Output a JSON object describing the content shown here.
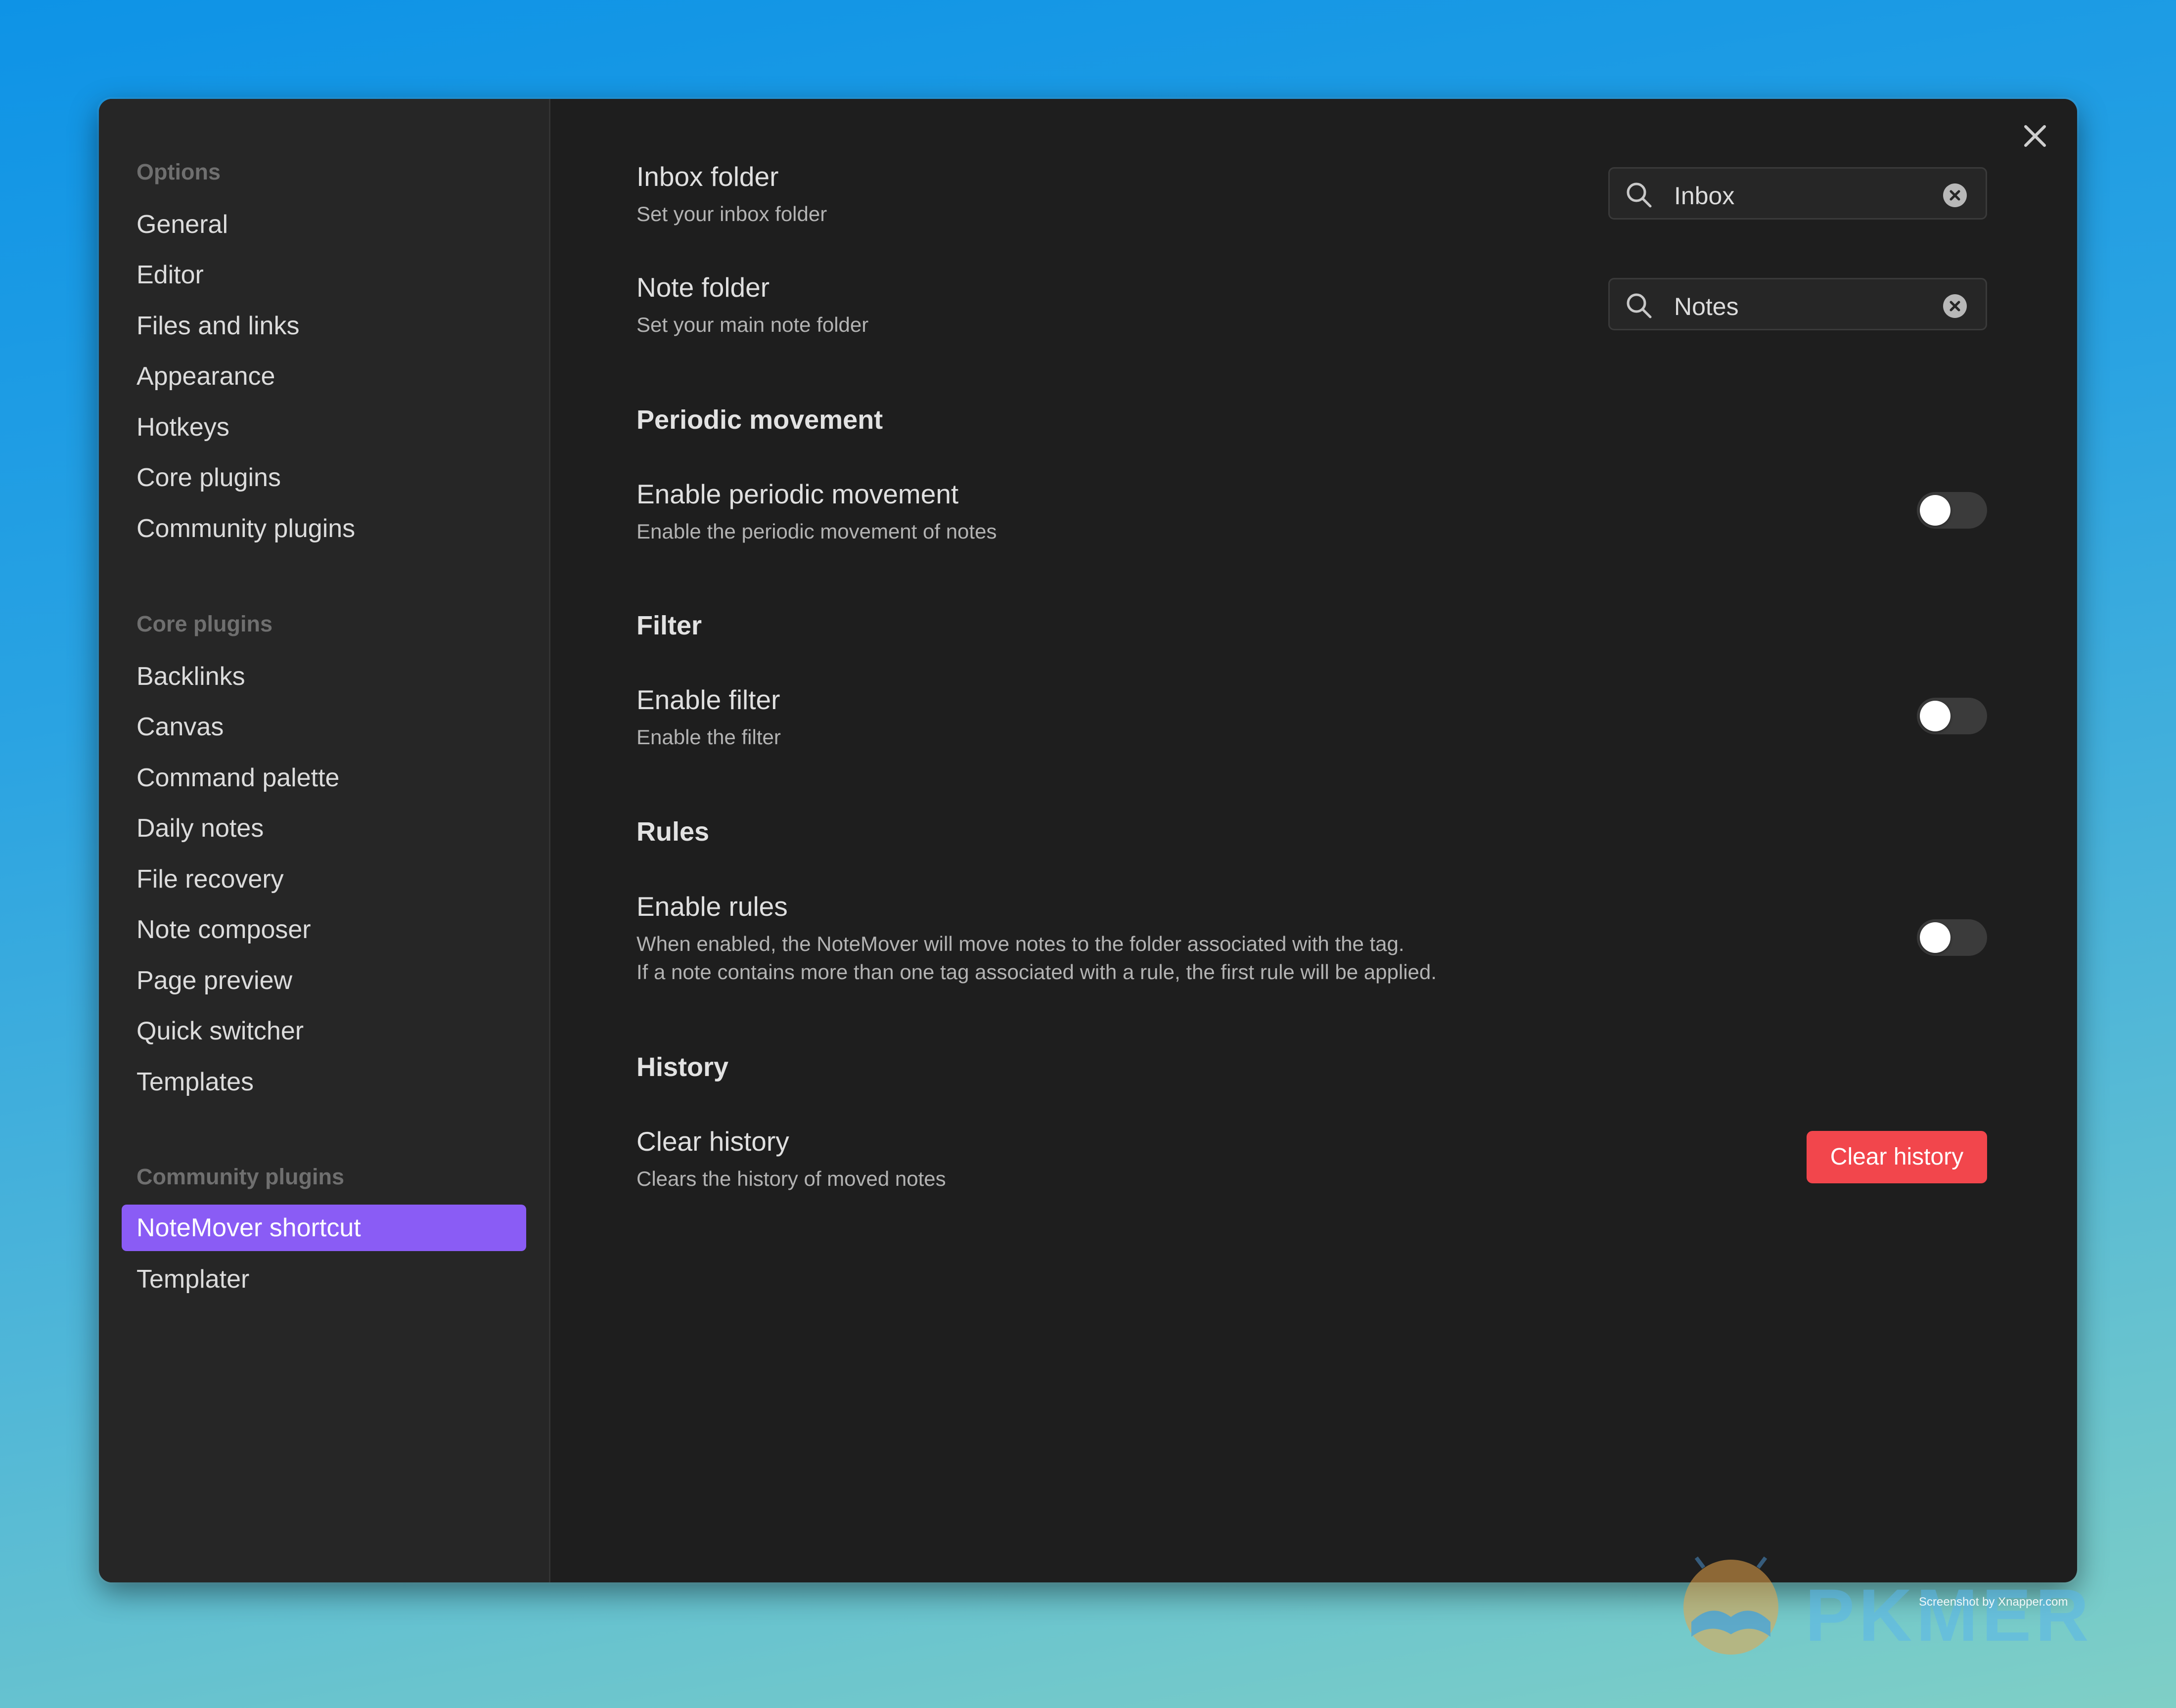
{
  "sidebar": {
    "options_header": "Options",
    "options_items": [
      "General",
      "Editor",
      "Files and links",
      "Appearance",
      "Hotkeys",
      "Core plugins",
      "Community plugins"
    ],
    "core_header": "Core plugins",
    "core_items": [
      "Backlinks",
      "Canvas",
      "Command palette",
      "Daily notes",
      "File recovery",
      "Note composer",
      "Page preview",
      "Quick switcher",
      "Templates"
    ],
    "community_header": "Community plugins",
    "community_active": "NoteMover shortcut",
    "community_items": [
      "Templater"
    ]
  },
  "settings": {
    "inbox": {
      "name": "Inbox folder",
      "desc": "Set your inbox folder",
      "value": "Inbox"
    },
    "note": {
      "name": "Note folder",
      "desc": "Set your main note folder",
      "value": "Notes"
    },
    "periodic": {
      "heading": "Periodic movement",
      "name": "Enable periodic movement",
      "desc": "Enable the periodic movement of notes",
      "enabled": false
    },
    "filter": {
      "heading": "Filter",
      "name": "Enable filter",
      "desc": "Enable the filter",
      "enabled": false
    },
    "rules": {
      "heading": "Rules",
      "name": "Enable rules",
      "desc_line1": "When enabled, the NoteMover will move notes to the folder associated with the tag.",
      "desc_line2": "If a note contains more than one tag associated with a rule, the first rule will be applied.",
      "enabled": false
    },
    "history": {
      "heading": "History",
      "name": "Clear history",
      "desc": "Clears the history of moved notes",
      "button_label": "Clear history"
    }
  },
  "watermark": {
    "brand": "PKMER",
    "credit": "Screenshot by Xnapper.com"
  },
  "colors": {
    "accent": "#8a5cf5",
    "danger": "#f2464c",
    "panel": "#1e1e1e",
    "sidebar": "#262626"
  }
}
